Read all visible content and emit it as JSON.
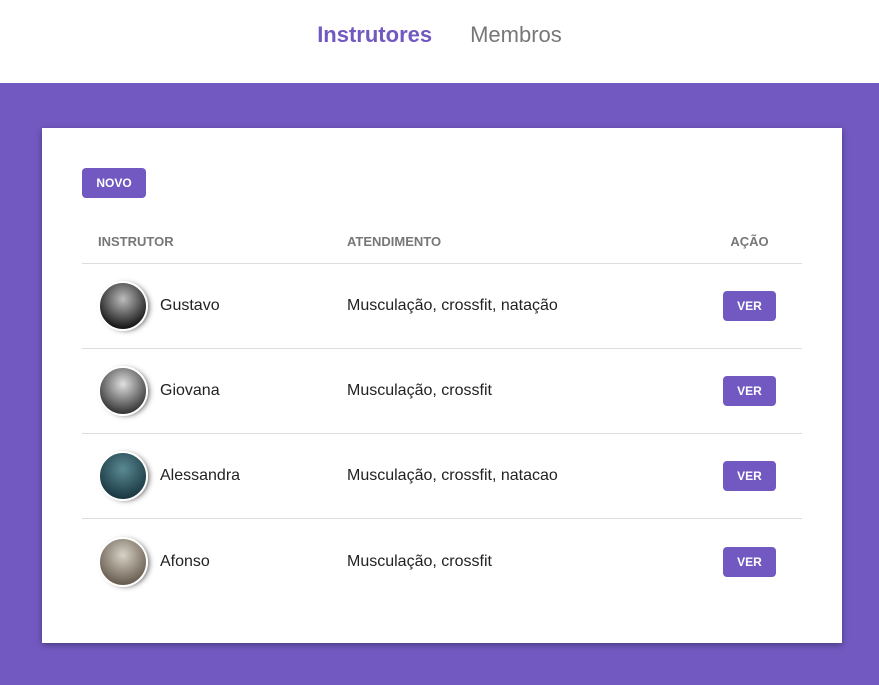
{
  "nav": {
    "links": [
      {
        "label": "Instrutores",
        "active": true
      },
      {
        "label": "Membros",
        "active": false
      }
    ]
  },
  "colors": {
    "accent": "#7159c1",
    "text": "#222222",
    "muted": "#777777"
  },
  "card": {
    "new_button_label": "Novo",
    "table": {
      "headers": {
        "instructor": "Instrutor",
        "service": "Atendimento",
        "action": "Ação"
      },
      "rows": [
        {
          "name": "Gustavo",
          "service": "Musculação, crossfit, natação",
          "action_label": "Ver",
          "avatar_colors": [
            "#bdbdbd",
            "#1a1a1a"
          ]
        },
        {
          "name": "Giovana",
          "service": "Musculação, crossfit",
          "action_label": "Ver",
          "avatar_colors": [
            "#e0e0e0",
            "#3a3a3a"
          ]
        },
        {
          "name": "Alessandra",
          "service": "Musculação, crossfit, natacao",
          "action_label": "Ver",
          "avatar_colors": [
            "#5a8a94",
            "#1c3a44"
          ]
        },
        {
          "name": "Afonso",
          "service": "Musculação, crossfit",
          "action_label": "Ver",
          "avatar_colors": [
            "#d8d2c6",
            "#6a5f52"
          ]
        }
      ]
    }
  }
}
